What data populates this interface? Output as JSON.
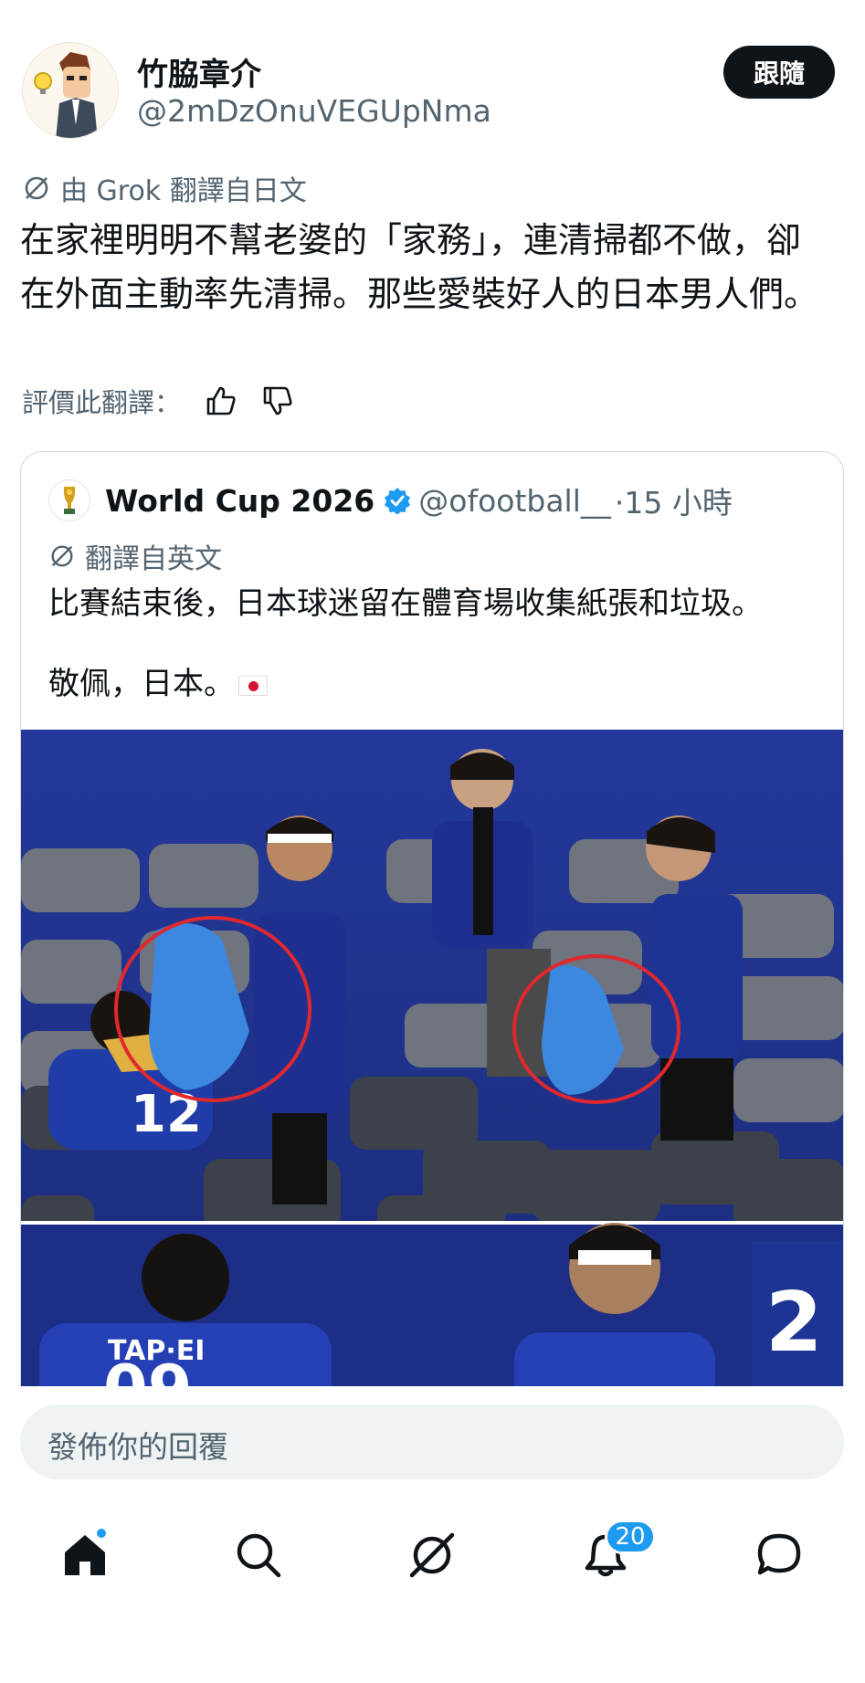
{
  "author": {
    "name": "竹脇章介",
    "handle": "@2mDzOnuVEGUpNma",
    "follow_label": "跟隨"
  },
  "translation_note": "由 Grok 翻譯自日文",
  "post_text": "在家裡明明不幫老婆的「家務」，連清掃都不做，卻在外面主動率先清掃。那些愛裝好人的日本男人們。",
  "rate_label": "評價此翻譯：",
  "quoted_post": {
    "name": "World Cup 2026",
    "handle": "@ofootball__",
    "time": "·15 小時",
    "translation_note": "翻譯自英文",
    "text_line1": "比賽結束後，日本球迷留在體育場收集紙張和垃圾。",
    "text_line2": "敬佩，日本。"
  },
  "reply_placeholder": "發佈你的回覆",
  "nav": {
    "notifications_badge": "20"
  },
  "colors": {
    "primary_text": "#0f1419",
    "secondary_text": "#536471",
    "accent": "#1d9bf0",
    "border": "#cfd9de"
  },
  "icons": [
    "avatar-cartoon",
    "grok-icon",
    "thumbs-up-icon",
    "thumbs-down-icon",
    "trophy-icon",
    "verified-icon",
    "home-icon",
    "search-icon",
    "grok-nav-icon",
    "bell-icon",
    "chat-icon"
  ]
}
